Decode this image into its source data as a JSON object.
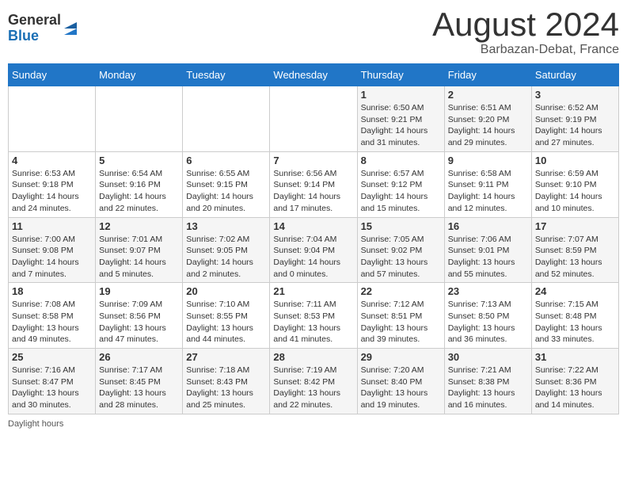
{
  "header": {
    "logo_general": "General",
    "logo_blue": "Blue",
    "month_title": "August 2024",
    "location": "Barbazan-Debat, France"
  },
  "weekdays": [
    "Sunday",
    "Monday",
    "Tuesday",
    "Wednesday",
    "Thursday",
    "Friday",
    "Saturday"
  ],
  "weeks": [
    [
      {
        "day": "",
        "info": ""
      },
      {
        "day": "",
        "info": ""
      },
      {
        "day": "",
        "info": ""
      },
      {
        "day": "",
        "info": ""
      },
      {
        "day": "1",
        "info": "Sunrise: 6:50 AM\nSunset: 9:21 PM\nDaylight: 14 hours\nand 31 minutes."
      },
      {
        "day": "2",
        "info": "Sunrise: 6:51 AM\nSunset: 9:20 PM\nDaylight: 14 hours\nand 29 minutes."
      },
      {
        "day": "3",
        "info": "Sunrise: 6:52 AM\nSunset: 9:19 PM\nDaylight: 14 hours\nand 27 minutes."
      }
    ],
    [
      {
        "day": "4",
        "info": "Sunrise: 6:53 AM\nSunset: 9:18 PM\nDaylight: 14 hours\nand 24 minutes."
      },
      {
        "day": "5",
        "info": "Sunrise: 6:54 AM\nSunset: 9:16 PM\nDaylight: 14 hours\nand 22 minutes."
      },
      {
        "day": "6",
        "info": "Sunrise: 6:55 AM\nSunset: 9:15 PM\nDaylight: 14 hours\nand 20 minutes."
      },
      {
        "day": "7",
        "info": "Sunrise: 6:56 AM\nSunset: 9:14 PM\nDaylight: 14 hours\nand 17 minutes."
      },
      {
        "day": "8",
        "info": "Sunrise: 6:57 AM\nSunset: 9:12 PM\nDaylight: 14 hours\nand 15 minutes."
      },
      {
        "day": "9",
        "info": "Sunrise: 6:58 AM\nSunset: 9:11 PM\nDaylight: 14 hours\nand 12 minutes."
      },
      {
        "day": "10",
        "info": "Sunrise: 6:59 AM\nSunset: 9:10 PM\nDaylight: 14 hours\nand 10 minutes."
      }
    ],
    [
      {
        "day": "11",
        "info": "Sunrise: 7:00 AM\nSunset: 9:08 PM\nDaylight: 14 hours\nand 7 minutes."
      },
      {
        "day": "12",
        "info": "Sunrise: 7:01 AM\nSunset: 9:07 PM\nDaylight: 14 hours\nand 5 minutes."
      },
      {
        "day": "13",
        "info": "Sunrise: 7:02 AM\nSunset: 9:05 PM\nDaylight: 14 hours\nand 2 minutes."
      },
      {
        "day": "14",
        "info": "Sunrise: 7:04 AM\nSunset: 9:04 PM\nDaylight: 14 hours\nand 0 minutes."
      },
      {
        "day": "15",
        "info": "Sunrise: 7:05 AM\nSunset: 9:02 PM\nDaylight: 13 hours\nand 57 minutes."
      },
      {
        "day": "16",
        "info": "Sunrise: 7:06 AM\nSunset: 9:01 PM\nDaylight: 13 hours\nand 55 minutes."
      },
      {
        "day": "17",
        "info": "Sunrise: 7:07 AM\nSunset: 8:59 PM\nDaylight: 13 hours\nand 52 minutes."
      }
    ],
    [
      {
        "day": "18",
        "info": "Sunrise: 7:08 AM\nSunset: 8:58 PM\nDaylight: 13 hours\nand 49 minutes."
      },
      {
        "day": "19",
        "info": "Sunrise: 7:09 AM\nSunset: 8:56 PM\nDaylight: 13 hours\nand 47 minutes."
      },
      {
        "day": "20",
        "info": "Sunrise: 7:10 AM\nSunset: 8:55 PM\nDaylight: 13 hours\nand 44 minutes."
      },
      {
        "day": "21",
        "info": "Sunrise: 7:11 AM\nSunset: 8:53 PM\nDaylight: 13 hours\nand 41 minutes."
      },
      {
        "day": "22",
        "info": "Sunrise: 7:12 AM\nSunset: 8:51 PM\nDaylight: 13 hours\nand 39 minutes."
      },
      {
        "day": "23",
        "info": "Sunrise: 7:13 AM\nSunset: 8:50 PM\nDaylight: 13 hours\nand 36 minutes."
      },
      {
        "day": "24",
        "info": "Sunrise: 7:15 AM\nSunset: 8:48 PM\nDaylight: 13 hours\nand 33 minutes."
      }
    ],
    [
      {
        "day": "25",
        "info": "Sunrise: 7:16 AM\nSunset: 8:47 PM\nDaylight: 13 hours\nand 30 minutes."
      },
      {
        "day": "26",
        "info": "Sunrise: 7:17 AM\nSunset: 8:45 PM\nDaylight: 13 hours\nand 28 minutes."
      },
      {
        "day": "27",
        "info": "Sunrise: 7:18 AM\nSunset: 8:43 PM\nDaylight: 13 hours\nand 25 minutes."
      },
      {
        "day": "28",
        "info": "Sunrise: 7:19 AM\nSunset: 8:42 PM\nDaylight: 13 hours\nand 22 minutes."
      },
      {
        "day": "29",
        "info": "Sunrise: 7:20 AM\nSunset: 8:40 PM\nDaylight: 13 hours\nand 19 minutes."
      },
      {
        "day": "30",
        "info": "Sunrise: 7:21 AM\nSunset: 8:38 PM\nDaylight: 13 hours\nand 16 minutes."
      },
      {
        "day": "31",
        "info": "Sunrise: 7:22 AM\nSunset: 8:36 PM\nDaylight: 13 hours\nand 14 minutes."
      }
    ]
  ],
  "footer": {
    "daylight_label": "Daylight hours"
  }
}
